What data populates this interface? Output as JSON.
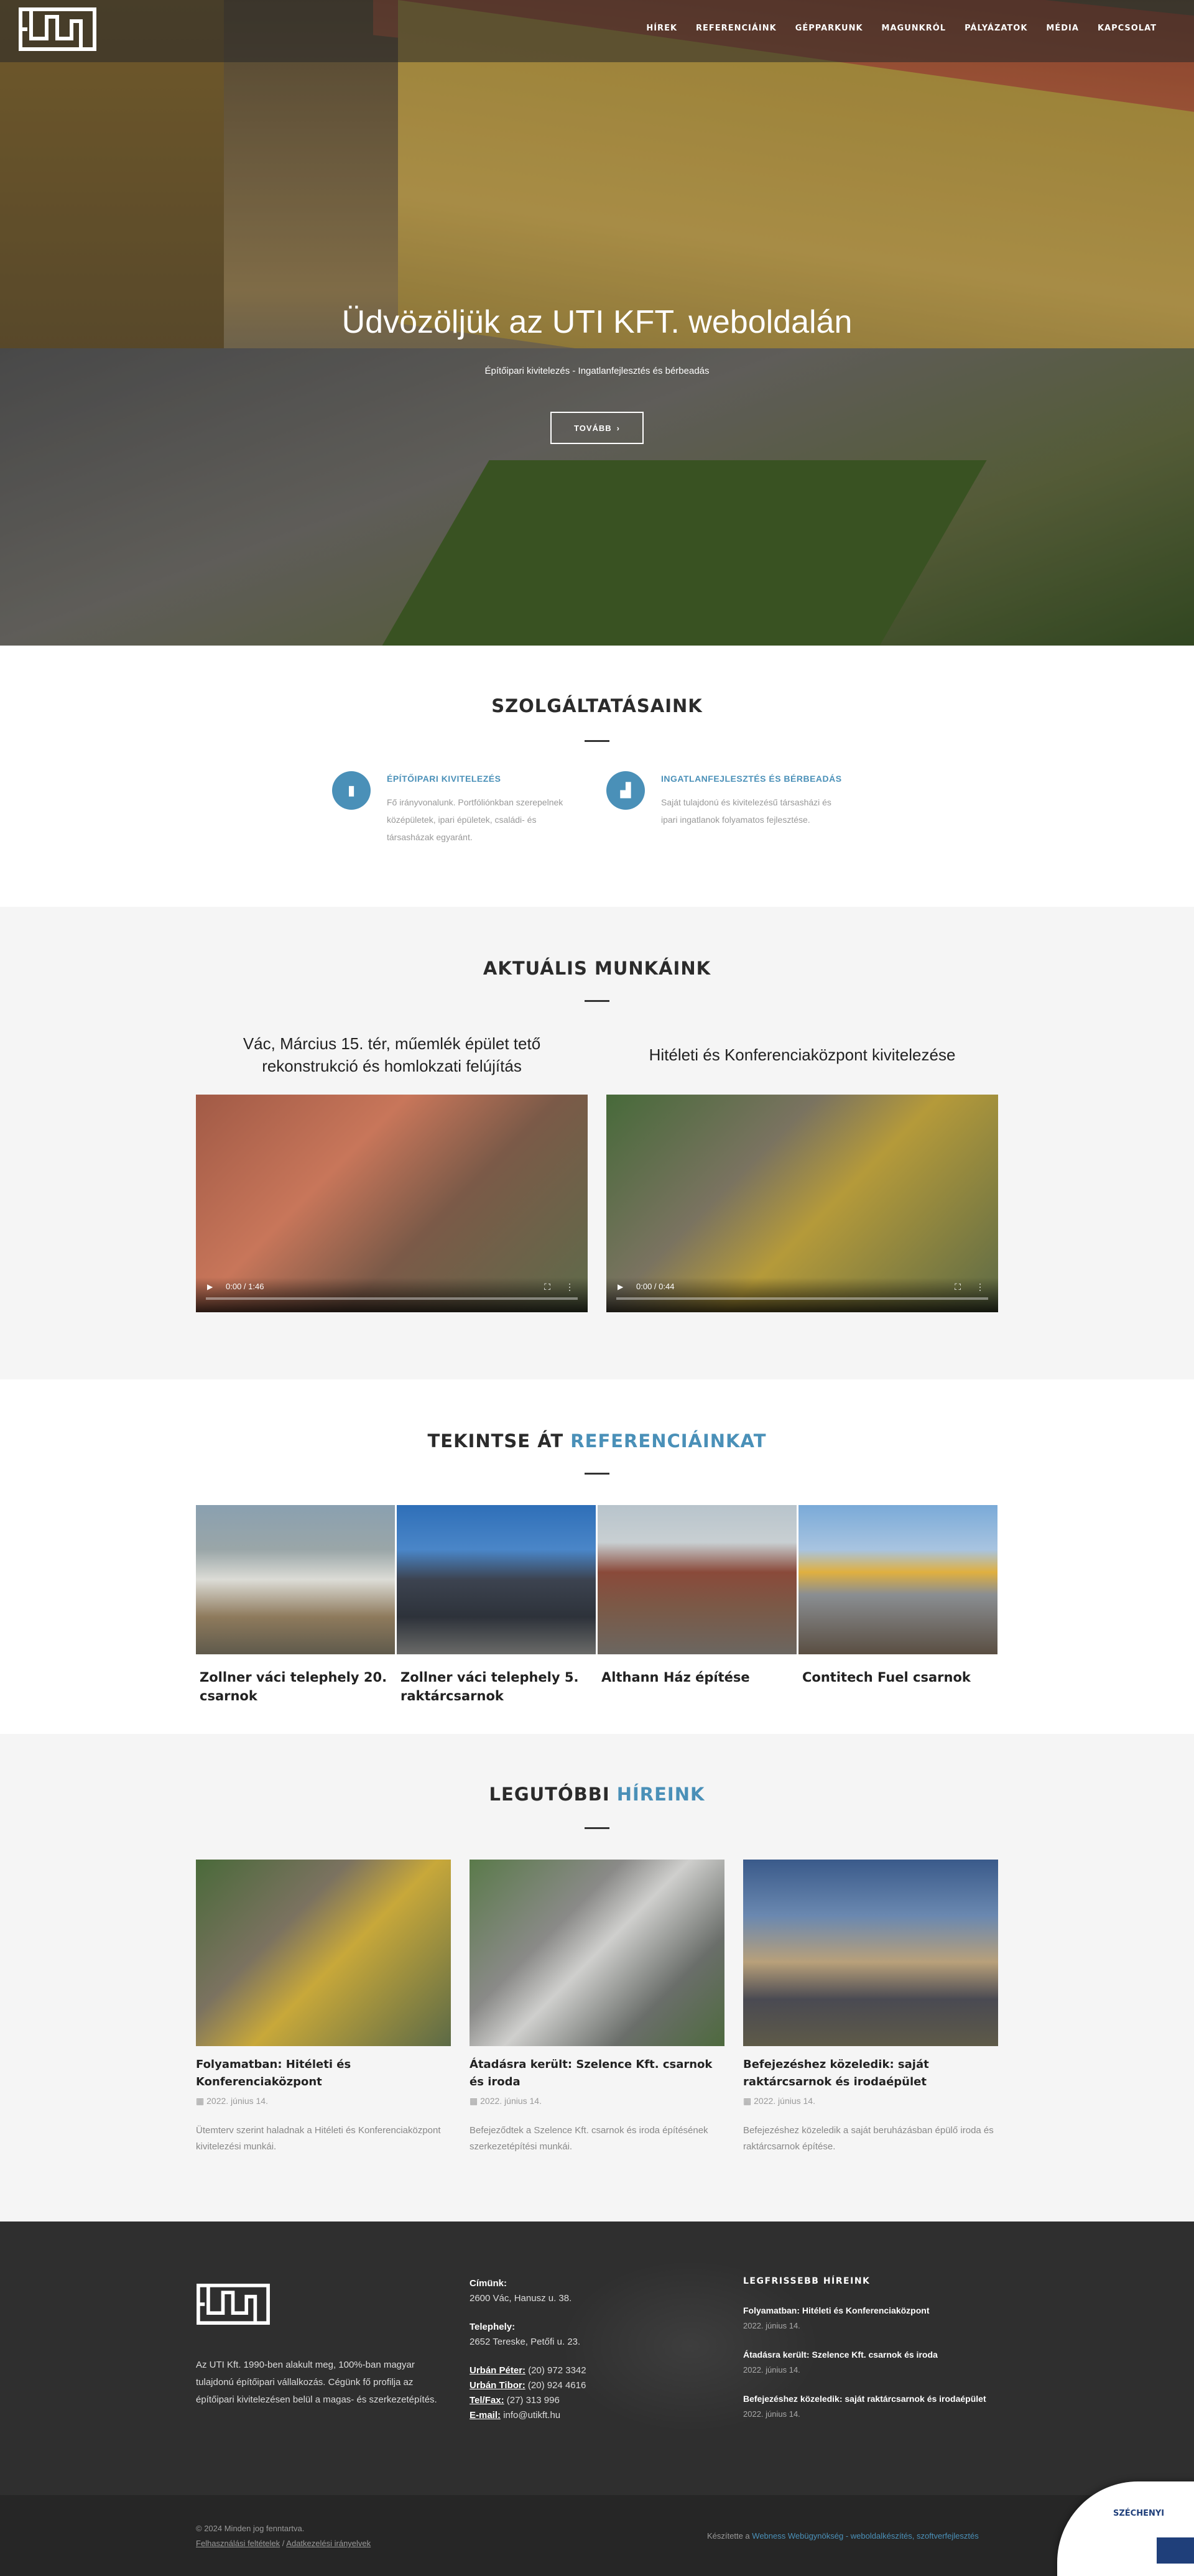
{
  "header": {
    "nav": [
      "HÍREK",
      "REFERENCIÁINK",
      "GÉPPARKUNK",
      "MAGUNKRÓL",
      "PÁLYÁZATOK",
      "MÉDIA",
      "KAPCSOLAT"
    ]
  },
  "hero": {
    "title": "Üdvözöljük az UTI KFT. weboldalán",
    "subtitle": "Építőipari kivitelezés - Ingatlanfejlesztés és bérbeadás",
    "button": "TOVÁBB"
  },
  "services": {
    "title": "SZOLGÁLTATÁSAINK",
    "items": [
      {
        "icon": "building-icon",
        "title": "ÉPÍTŐIPARI KIVITELEZÉS",
        "text": "Fő irányvonalunk. Portfóliónkban szerepelnek középületek, ipari épületek, családi- és társasházak egyaránt."
      },
      {
        "icon": "chart-icon",
        "title": "INGATLANFEJLESZTÉS ÉS BÉRBEADÁS",
        "text": "Saját tulajdonú és kivitelezésű társasházi és ipari ingatlanok folyamatos fejlesztése."
      }
    ]
  },
  "works": {
    "title": "AKTUÁLIS MUNKÁINK",
    "items": [
      {
        "title": "Vác, Március 15. tér, műemlék épület tető rekonstrukció és homlokzati felújítás",
        "time": "0:00 / 1:46"
      },
      {
        "title": "Hitéleti és Konferenciaközpont kivitelezése",
        "time": "0:00 / 0:44"
      }
    ]
  },
  "refs": {
    "title_a": "TEKINTSE ÁT",
    "title_b": "REFERENCIÁINKAT",
    "items": [
      {
        "title": "Zollner váci telephely 20. csarnok"
      },
      {
        "title": "Zollner váci telephely 5. raktárcsarnok"
      },
      {
        "title": "Althann Ház építése"
      },
      {
        "title": "Contitech Fuel csarnok"
      }
    ]
  },
  "news": {
    "title_a": "LEGUTÓBBI",
    "title_b": "HÍREINK",
    "items": [
      {
        "title": "Folyamatban: Hitéleti és Konferenciaközpont",
        "date": "2022. június 14.",
        "text": "Ütemterv szerint haladnak a Hitéleti és Konferenciaközpont kivitelezési munkái."
      },
      {
        "title": "Átadásra került: Szelence Kft. csarnok és iroda",
        "date": "2022. június 14.",
        "text": "Befejeződtek a Szelence Kft. csarnok és iroda építésének szerkezetépítési munkái."
      },
      {
        "title": "Befejezéshez közeledik: saját raktárcsarnok és irodaépület",
        "date": "2022. június 14.",
        "text": "Befejezéshez közeledik a saját beruházásban épülő iroda és raktárcsarnok építése."
      }
    ]
  },
  "footer": {
    "about": "Az UTI Kft. 1990-ben alakult meg, 100%-ban magyar tulajdonú építőipari vállalkozás. Cégünk fő profilja az építőipari kivitelezésen belül a magas- és szerkezetépítés.",
    "contact": {
      "cim_label": "Címünk:",
      "cim": "2600 Vác, Hanusz u. 38.",
      "telep_label": "Telephely:",
      "telep": "2652 Tereske, Petőfi u. 23.",
      "p1_label": "Urbán Péter:",
      "p1": "(20) 972 3342",
      "p2_label": "Urbán Tibor:",
      "p2": "(20) 924 4616",
      "fax_label": "Tel/Fax:",
      "fax": "(27) 313 996",
      "mail_label": "E-mail:",
      "mail": "info@utikft.hu"
    },
    "news_title": "LEGFRISSEBB HÍREINK",
    "news": [
      {
        "title": "Folyamatban: Hitéleti és Konferenciaközpont",
        "date": "2022. június 14."
      },
      {
        "title": "Átadásra került: Szelence Kft. csarnok és iroda",
        "date": "2022. június 14."
      },
      {
        "title": "Befejezéshez közeledik: saját raktárcsarnok és irodaépület",
        "date": "2022. június 14."
      }
    ]
  },
  "bottom": {
    "copy": "© 2024 Minden jog fenntartva.",
    "link1": "Felhasználási feltételek",
    "sep": "/",
    "link2": "Adatkezelési irányelvek",
    "credit_pre": "Készítette a",
    "credit_link": "Webness Webügynökség - weboldalkészítés, szoftverfejlesztés"
  },
  "badge": {
    "title": "SZÉCHENYI"
  },
  "colors": {
    "accent": "#4a90b8",
    "footer": "#2f2f2f"
  }
}
